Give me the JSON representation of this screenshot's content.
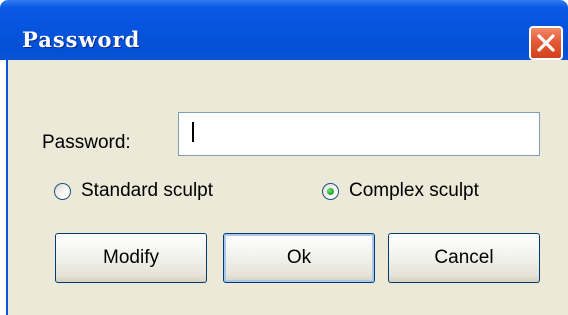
{
  "window": {
    "title": "Password"
  },
  "form": {
    "password_label": "Password:",
    "password_value": ""
  },
  "radio": {
    "standard_label": "Standard sculpt",
    "standard_checked": false,
    "complex_label": "Complex sculpt",
    "complex_checked": true
  },
  "buttons": {
    "modify_label": "Modify",
    "ok_label": "Ok",
    "cancel_label": "Cancel"
  },
  "colors": {
    "titlebar": "#0654dd",
    "close_button": "#e35a35",
    "client_background": "#ece9d8",
    "radio_selected": "#21a121"
  },
  "icons": {
    "close": "close-icon"
  }
}
